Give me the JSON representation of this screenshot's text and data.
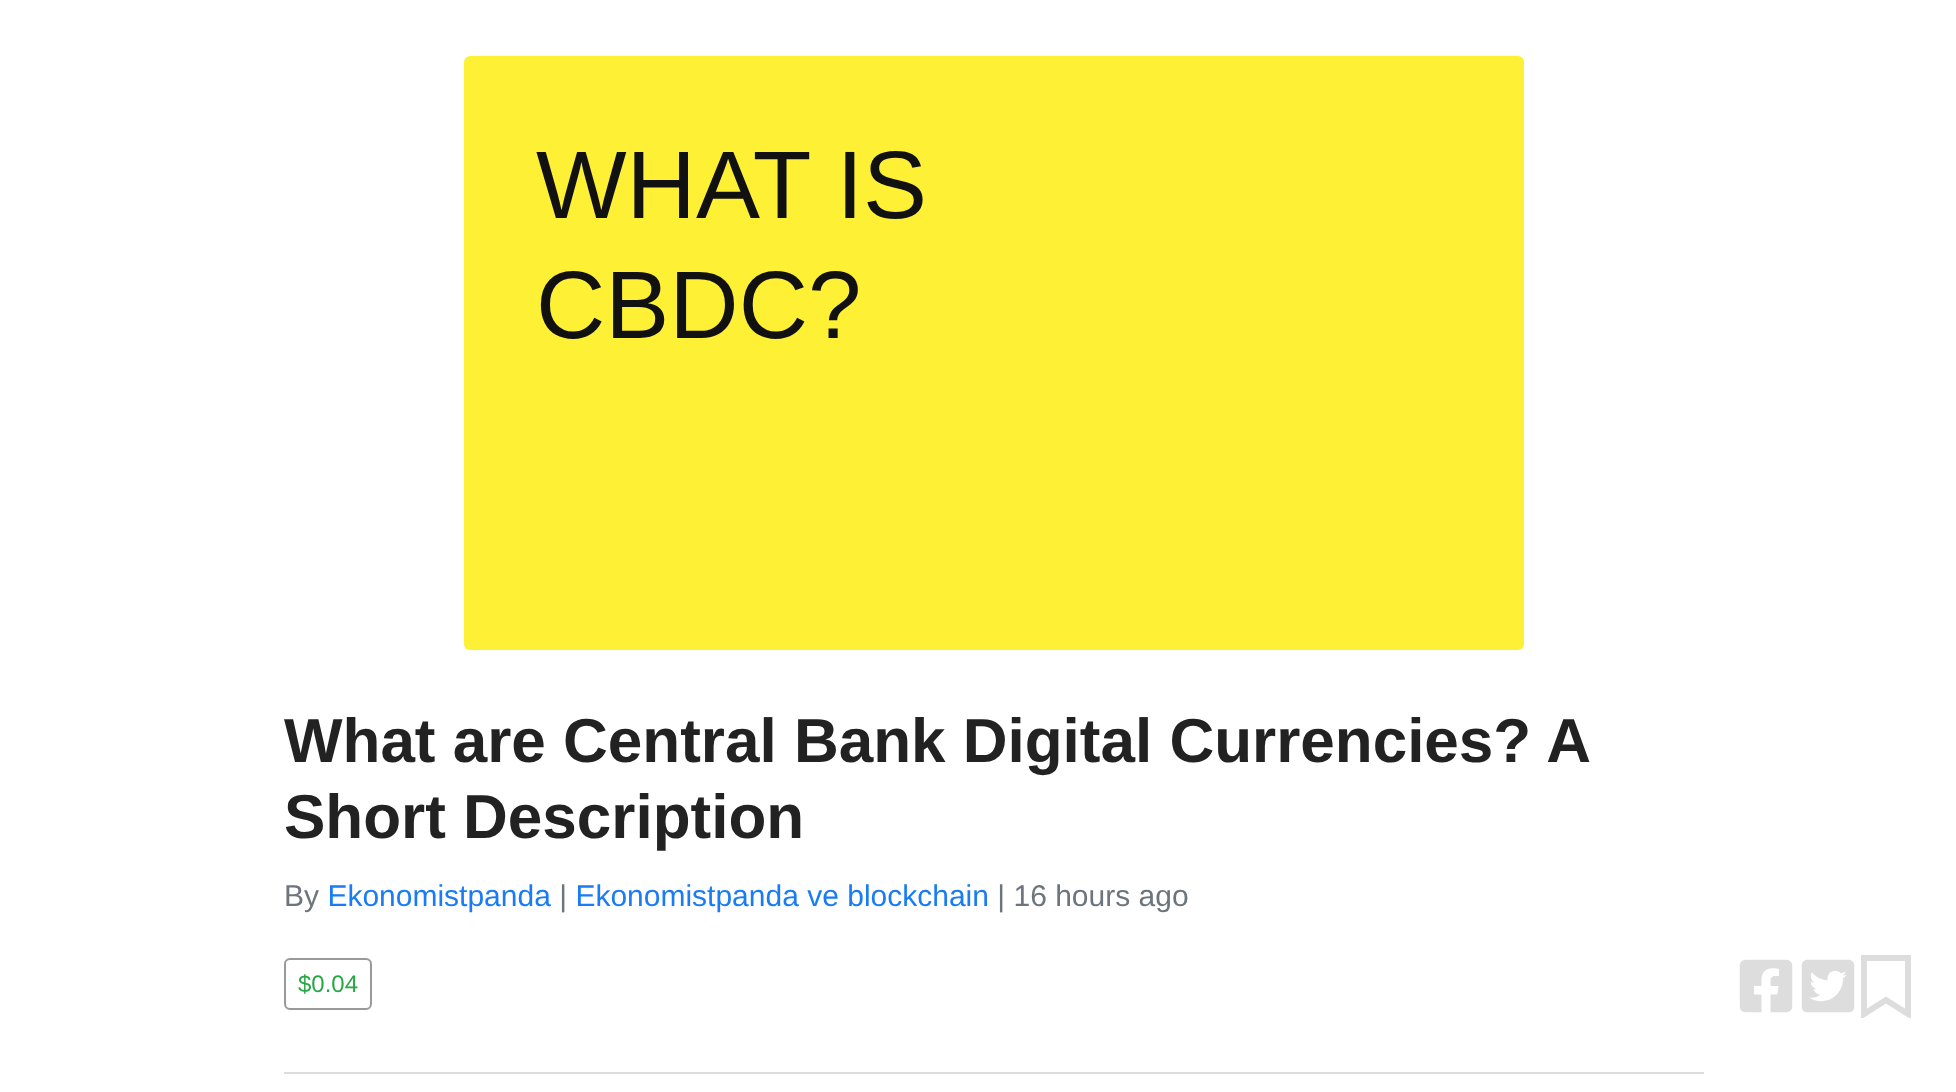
{
  "cover": {
    "lines": [
      "WHAT IS",
      "CBDC?"
    ]
  },
  "title": "What are Central Bank Digital Currencies? A Short Description",
  "byline": {
    "prefix": "By",
    "author": "Ekonomistpanda",
    "separator": "|",
    "community": "Ekonomistpanda ve blockchain",
    "time": "16 hours ago"
  },
  "payout": "$0.04"
}
